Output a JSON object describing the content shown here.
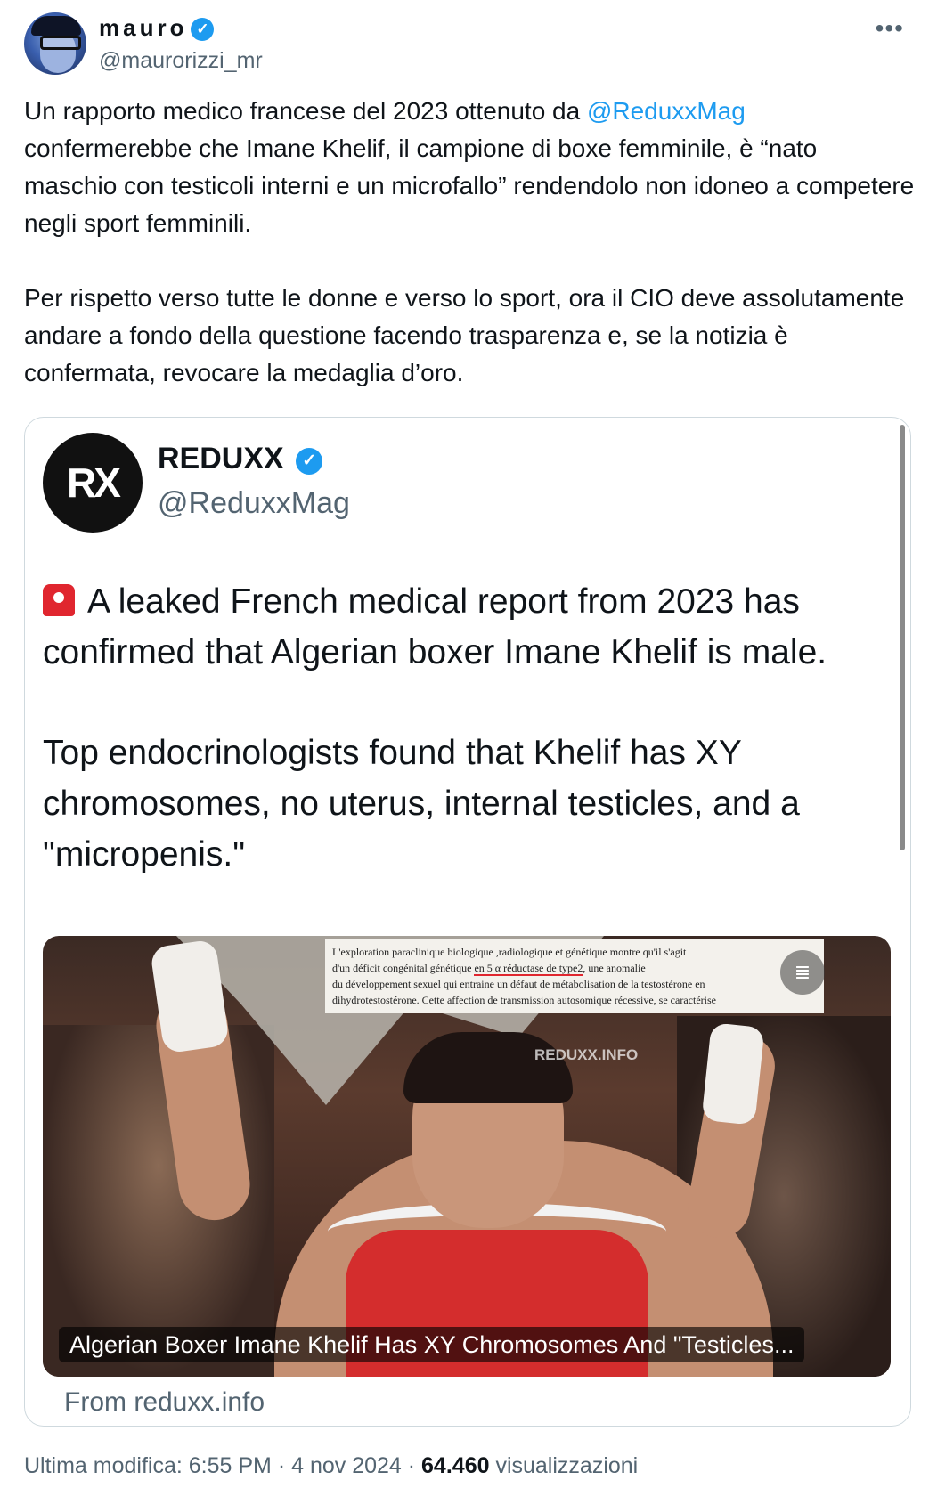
{
  "tweet": {
    "author": {
      "name": "mauro",
      "handle": "@maurorizzi_mr",
      "verified": true
    },
    "more_icon": "more-horizontal-icon",
    "paragraphs": [
      {
        "before": "Un rapporto medico francese del 2023 ottenuto da ",
        "mention": "@ReduxxMag",
        "after": " confermerebbe che Imane Khelif, il campione di boxe femminile, è “nato maschio con testicoli interni e un microfallo” rendendolo non idoneo a competere negli sport femminili."
      },
      {
        "text": "Per rispetto verso tutte le donne e verso lo sport, ora il CIO deve assolutamente andare a fondo della questione facendo trasparenza e, se la notizia è confermata, revocare la medaglia d’oro."
      }
    ],
    "meta": {
      "edited": "Ultima modifica: 6:55 PM",
      "sep1": " · ",
      "date": "4 nov 2024",
      "sep2": " · ",
      "views": "64.460",
      "views_label": " visualizzazioni"
    }
  },
  "quote": {
    "author": {
      "name": "REDUXX",
      "handle": "@ReduxxMag",
      "verified": true,
      "avatar_text": "RX"
    },
    "line1": "A leaked French medical report from 2023 has confirmed that Algerian boxer Imane Khelif is male.",
    "line2": "Top endocrinologists found that Khelif has XY chromosomes, no uterus, internal testicles, and a \"micropenis.\"",
    "media": {
      "doc_lines": [
        "L'exploration paraclinique biologique ,radiologique et génétique montre qu'il s'agit",
        "d'un déficit congénital génétique",
        "en 5 α réductase de type2",
        "une anomalie",
        "du développement sexuel qui entraine un défaut de métabolisation de la testostérone en",
        "dihydrotestostérone. Cette affection de transmission autosomique récessive, se caractérise"
      ],
      "watermark": "REDUXX.INFO",
      "caption": "Algerian Boxer Imane Khelif Has XY Chromosomes And \"Testicles..."
    },
    "source": "From reduxx.info"
  },
  "colors": {
    "accent": "#1d9bf0",
    "secondary_text": "#536471",
    "border": "#cfd9de"
  }
}
